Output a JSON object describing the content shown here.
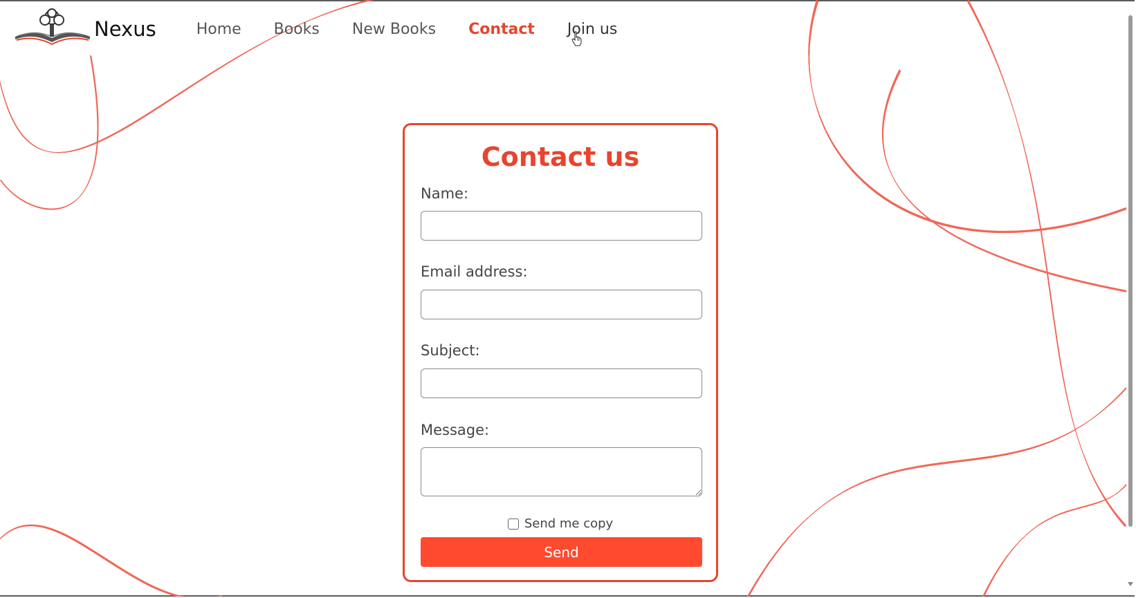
{
  "brand": {
    "name": "Nexus",
    "logo_icon": "book-tree-logo-icon"
  },
  "nav": {
    "items": [
      {
        "label": "Home",
        "state": "normal"
      },
      {
        "label": "Books",
        "state": "normal"
      },
      {
        "label": "New Books",
        "state": "normal"
      },
      {
        "label": "Contact",
        "state": "active"
      },
      {
        "label": "Join us",
        "state": "hover"
      }
    ]
  },
  "form": {
    "title": "Contact us",
    "name_label": "Name:",
    "name_value": "",
    "email_label": "Email address:",
    "email_value": "",
    "subject_label": "Subject:",
    "subject_value": "",
    "message_label": "Message:",
    "message_value": "",
    "copy_label": "Send me copy",
    "copy_checked": false,
    "send_label": "Send"
  },
  "colors": {
    "accent": "#e8442e",
    "button": "#ff4a30",
    "wave": "#f26a5a"
  }
}
